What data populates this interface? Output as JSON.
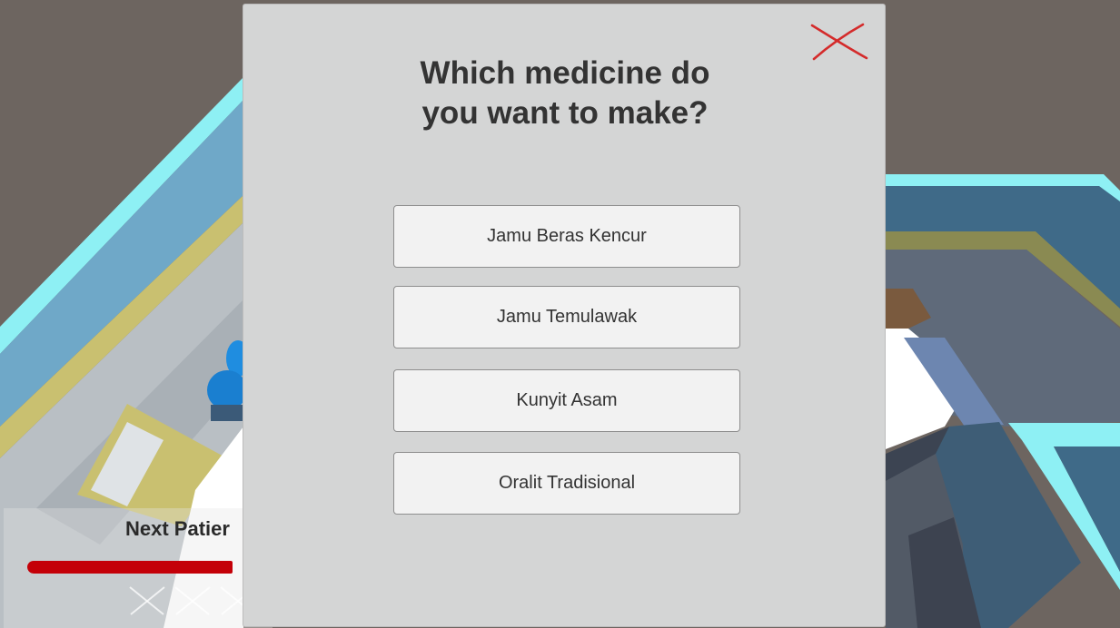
{
  "dialog": {
    "title": "Which medicine do\nyou want to make?",
    "close_icon": "close-x-icon",
    "close_color": "#d42b2b",
    "options": [
      {
        "label": "Jamu Beras Kencur"
      },
      {
        "label": "Jamu Temulawak"
      },
      {
        "label": "Kunyit Asam"
      },
      {
        "label": "Oralit Tradisional"
      }
    ]
  },
  "hud": {
    "next_patient_label": "Next Patier",
    "timer_fraction": 1.0,
    "timer_color": "#c40008",
    "strike_icon": "cross-icon",
    "strikes_total": 3
  },
  "colors": {
    "dialog_background": "#d4d5d5",
    "button_background": "#f2f2f2",
    "wall_cyan": "#8ef0f4",
    "wall_blue": "#6fa8c8",
    "floor_gray": "#b9bfc4",
    "tile_yellow": "#c9c070",
    "character_blue": "#1f8de0"
  }
}
